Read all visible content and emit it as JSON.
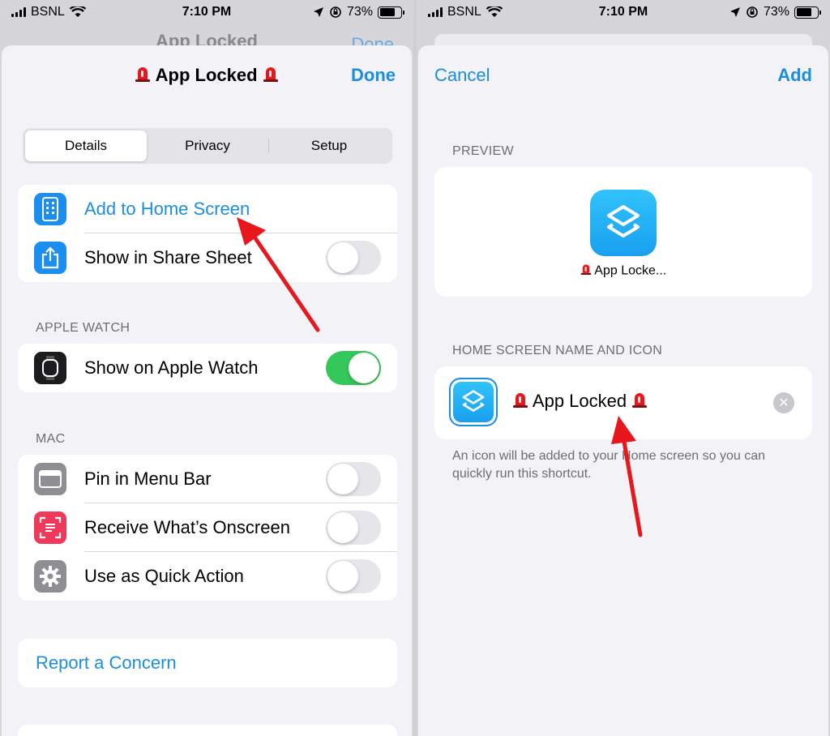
{
  "status_bar": {
    "carrier": "BSNL",
    "time": "7:10 PM",
    "battery": "73%"
  },
  "left": {
    "behind_title": "App Locked",
    "behind_done": "Done",
    "title": "App Locked",
    "done": "Done",
    "tabs": [
      {
        "label": "Details",
        "active": true
      },
      {
        "label": "Privacy",
        "active": false
      },
      {
        "label": "Setup",
        "active": false
      }
    ],
    "general_rows": [
      {
        "label": "Add to Home Screen",
        "icon": "home-screen-icon",
        "is_link": true
      },
      {
        "label": "Show in Share Sheet",
        "icon": "share-icon",
        "toggle": false
      }
    ],
    "apple_watch_header": "APPLE WATCH",
    "apple_watch_row": {
      "label": "Show on Apple Watch",
      "icon": "watch-icon",
      "toggle": true
    },
    "mac_header": "MAC",
    "mac_rows": [
      {
        "label": "Pin in Menu Bar",
        "icon": "menu-bar-icon",
        "toggle": false
      },
      {
        "label": "Receive What’s Onscreen",
        "icon": "onscreen-icon",
        "toggle": false
      },
      {
        "label": "Use as Quick Action",
        "icon": "gear-icon",
        "toggle": false
      }
    ],
    "report": "Report a Concern"
  },
  "right": {
    "cancel": "Cancel",
    "add": "Add",
    "preview_header": "PREVIEW",
    "preview_label": "App Locke...",
    "name_header": "HOME SCREEN NAME AND ICON",
    "name_value": "App Locked",
    "footer": "An icon will be added to your Home screen so you can quickly run this shortcut."
  },
  "colors": {
    "accent": "#1a8ee0",
    "toggle_on": "#34c759",
    "annotation_arrow": "#e8161d"
  }
}
